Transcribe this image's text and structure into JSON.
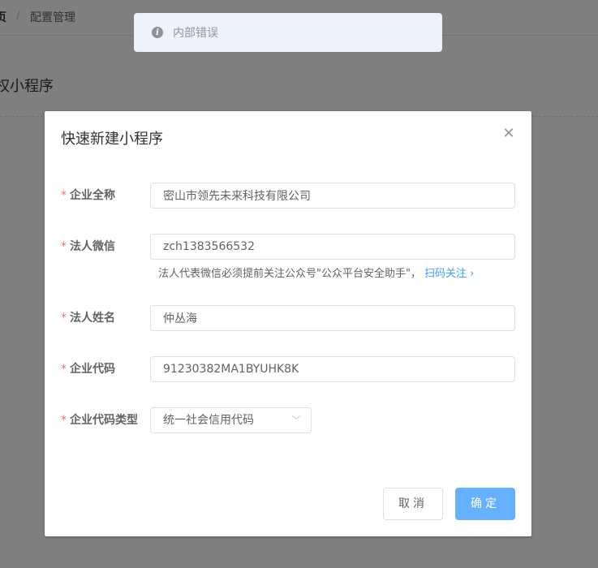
{
  "breadcrumb": {
    "home": "页",
    "separator": "/",
    "current": "配置管理"
  },
  "page": {
    "title": "权小程序"
  },
  "toast": {
    "icon": "info-icon",
    "message": "内部错误"
  },
  "dialog": {
    "title": "快速新建小程序",
    "close_icon": "close-icon",
    "fields": {
      "company_name": {
        "label": "企业全称",
        "value": "密山市领先未来科技有限公司"
      },
      "legal_wechat": {
        "label": "法人微信",
        "value": "zch1383566532"
      },
      "legal_name": {
        "label": "法人姓名",
        "value": "仲丛海"
      },
      "company_code": {
        "label": "企业代码",
        "value": "91230382MA1BYUHK8K"
      },
      "code_type": {
        "label": "企业代码类型",
        "value": "统一社会信用代码"
      }
    },
    "required_mark": "*",
    "hint": {
      "text": "法人代表微信必须提前关注公众号\"公众平台安全助手\"，",
      "link": "扫码关注",
      "link_icon": "chevron-right-icon"
    },
    "buttons": {
      "cancel": "取消",
      "confirm": "确定"
    }
  },
  "colors": {
    "primary_light": "#66b1ff",
    "link": "#409eff",
    "required": "#f56c6c",
    "toast_bg": "#edf2fc"
  }
}
